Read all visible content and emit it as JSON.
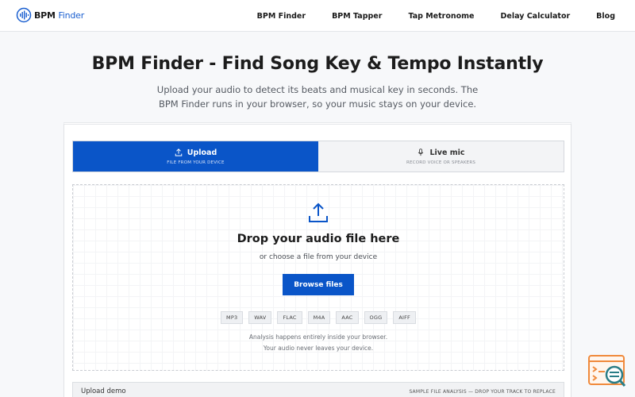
{
  "header": {
    "logo_text": "BPM",
    "logo_accent": "Finder",
    "nav": [
      "BPM Finder",
      "BPM Tapper",
      "Tap Metronome",
      "Delay Calculator",
      "Blog"
    ]
  },
  "hero": {
    "title": "BPM Finder - Find Song Key & Tempo Instantly",
    "subtitle_line1": "Upload your audio to detect its beats and musical key in seconds. The",
    "subtitle_line2": "BPM Finder runs in your browser, so your music stays on your device."
  },
  "tabs": [
    {
      "label": "Upload",
      "sub": "FILE FROM YOUR DEVICE",
      "icon": "upload-icon",
      "active": true
    },
    {
      "label": "Live mic",
      "sub": "RECORD VOICE OR SPEAKERS",
      "icon": "microphone-icon",
      "active": false
    }
  ],
  "dropzone": {
    "title": "Drop your audio file here",
    "subtitle": "or choose a file from your device",
    "button": "Browse files",
    "formats": [
      "MP3",
      "WAV",
      "FLAC",
      "M4A",
      "AAC",
      "OGG",
      "AIFF"
    ],
    "note_line1": "Analysis happens entirely inside your browser.",
    "note_line2": "Your audio never leaves your device."
  },
  "demo": {
    "label": "Upload demo",
    "right": "SAMPLE FILE ANALYSIS — DROP YOUR TRACK TO REPLACE"
  },
  "colors": {
    "primary": "#0a55c8",
    "widget_orange": "#f08a3c",
    "widget_teal": "#2a7d86"
  }
}
